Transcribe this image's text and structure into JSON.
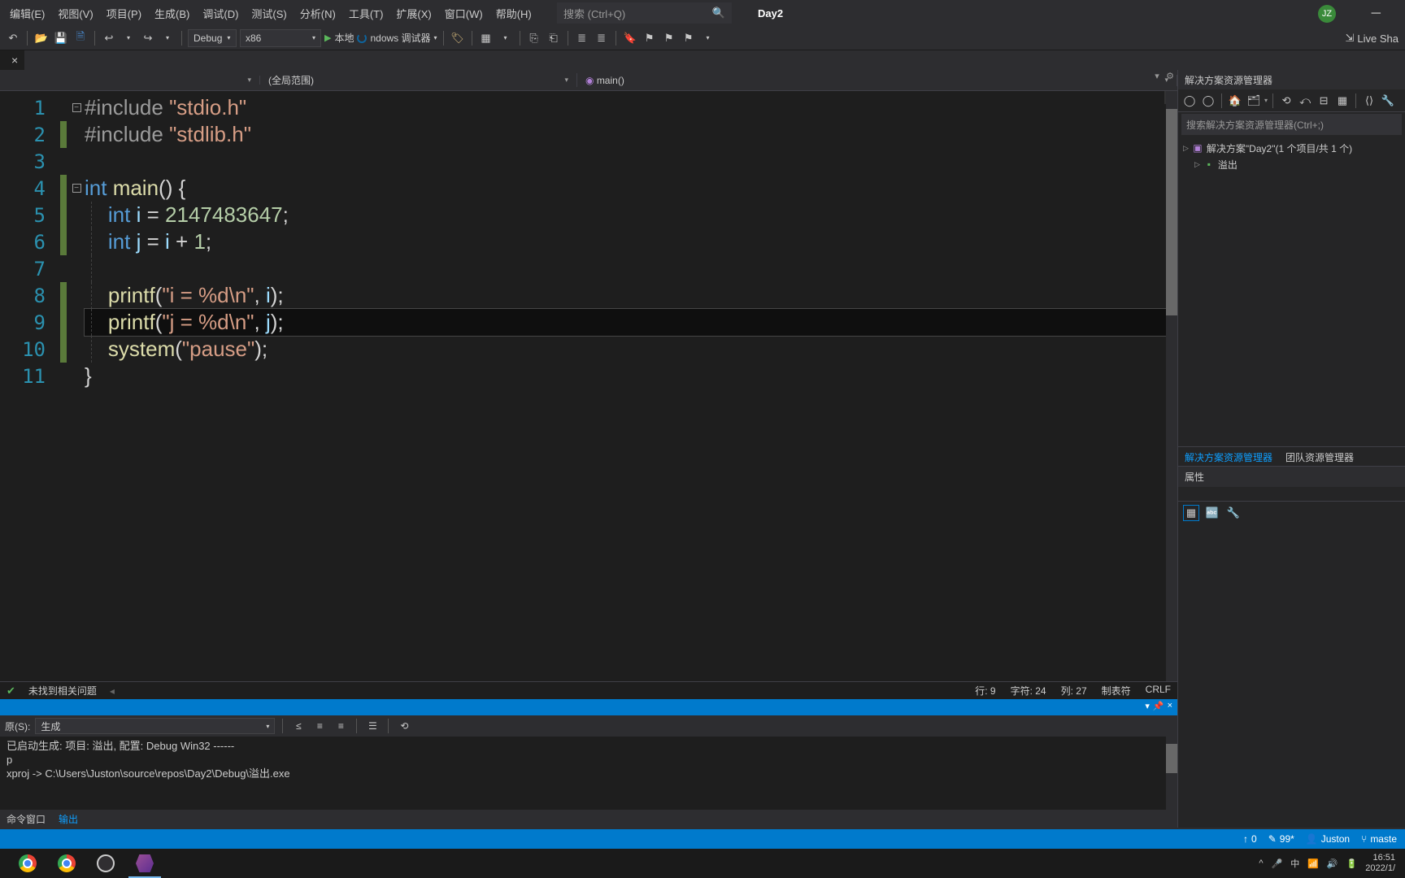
{
  "menu": [
    "编辑(E)",
    "视图(V)",
    "项目(P)",
    "生成(B)",
    "调试(D)",
    "测试(S)",
    "分析(N)",
    "工具(T)",
    "扩展(X)",
    "窗口(W)",
    "帮助(H)"
  ],
  "search_placeholder": "搜索 (Ctrl+Q)",
  "solution_badge": "Day2",
  "avatar": "JZ",
  "toolbar": {
    "config": "Debug",
    "platform": "x86",
    "debugger": "本地 Windows 调试器"
  },
  "liveshare": "Live Sha",
  "tab": {
    "name": ""
  },
  "nav": {
    "scope": "(全局范围)",
    "func": "main()"
  },
  "code_lines": [
    {
      "n": 1,
      "changed": false,
      "fold": "minus",
      "seg": [
        [
          "pp",
          "#include "
        ],
        [
          "str",
          "\"stdio.h\""
        ]
      ]
    },
    {
      "n": 2,
      "changed": true,
      "seg": [
        [
          "pp",
          "#include "
        ],
        [
          "str",
          "\"stdlib.h\""
        ]
      ]
    },
    {
      "n": 3,
      "changed": false,
      "seg": []
    },
    {
      "n": 4,
      "changed": true,
      "fold": "minus",
      "seg": [
        [
          "kw",
          "int "
        ],
        [
          "fn",
          "main"
        ],
        [
          "pl",
          "() {"
        ]
      ]
    },
    {
      "n": 5,
      "changed": true,
      "indent": 1,
      "seg": [
        [
          "pl",
          "    "
        ],
        [
          "kw",
          "int "
        ],
        [
          "id",
          "i"
        ],
        [
          "pl",
          " = "
        ],
        [
          "num",
          "2147483647"
        ],
        [
          "pl",
          ";"
        ]
      ]
    },
    {
      "n": 6,
      "changed": true,
      "indent": 1,
      "seg": [
        [
          "pl",
          "    "
        ],
        [
          "kw",
          "int "
        ],
        [
          "id",
          "j"
        ],
        [
          "pl",
          " = "
        ],
        [
          "id",
          "i"
        ],
        [
          "pl",
          " + "
        ],
        [
          "num",
          "1"
        ],
        [
          "pl",
          ";"
        ]
      ]
    },
    {
      "n": 7,
      "changed": false,
      "indent": 1,
      "seg": []
    },
    {
      "n": 8,
      "changed": true,
      "indent": 1,
      "seg": [
        [
          "pl",
          "    "
        ],
        [
          "fn",
          "printf"
        ],
        [
          "pl",
          "("
        ],
        [
          "str",
          "\"i = %d\\n\""
        ],
        [
          "pl",
          ", "
        ],
        [
          "id",
          "i"
        ],
        [
          "pl",
          ");"
        ]
      ]
    },
    {
      "n": 9,
      "changed": true,
      "indent": 1,
      "hl": true,
      "seg": [
        [
          "pl",
          "    "
        ],
        [
          "fn",
          "printf"
        ],
        [
          "pl",
          "("
        ],
        [
          "str",
          "\"j = %d\\n\""
        ],
        [
          "pl",
          ", "
        ],
        [
          "id",
          "j"
        ],
        [
          "pl",
          ");"
        ]
      ]
    },
    {
      "n": 10,
      "changed": true,
      "indent": 1,
      "seg": [
        [
          "pl",
          "    "
        ],
        [
          "fn",
          "system"
        ],
        [
          "pl",
          "("
        ],
        [
          "str",
          "\"pause\""
        ],
        [
          "pl",
          ");"
        ]
      ]
    },
    {
      "n": 11,
      "changed": false,
      "seg": [
        [
          "pl",
          "}"
        ]
      ]
    }
  ],
  "status": {
    "issues": "未找到相关问题",
    "line": "行: 9",
    "char": "字符: 24",
    "col": "列: 27",
    "tabs": "制表符",
    "eol": "CRLF"
  },
  "output": {
    "source_label": "原(S):",
    "source": "生成",
    "text": "已启动生成: 项目: 溢出, 配置: Debug Win32 ------\np\nxproj -> C:\\Users\\Juston\\source\\repos\\Day2\\Debug\\溢出.exe",
    "tabs": [
      "命令窗口",
      "输出"
    ]
  },
  "solution_explorer": {
    "title": "解决方案资源管理器",
    "search": "搜索解决方案资源管理器(Ctrl+;)",
    "root": "解决方案\"Day2\"(1 个项目/共 1 个)",
    "project": "溢出",
    "tabs": [
      "解决方案资源管理器",
      "团队资源管理器"
    ]
  },
  "properties": {
    "title": "属性"
  },
  "bottom_status": {
    "up": "0",
    "edits": "99*",
    "user": "Juston",
    "branch": "maste"
  },
  "tray": {
    "time": "16:51",
    "date": "2022/1/"
  }
}
